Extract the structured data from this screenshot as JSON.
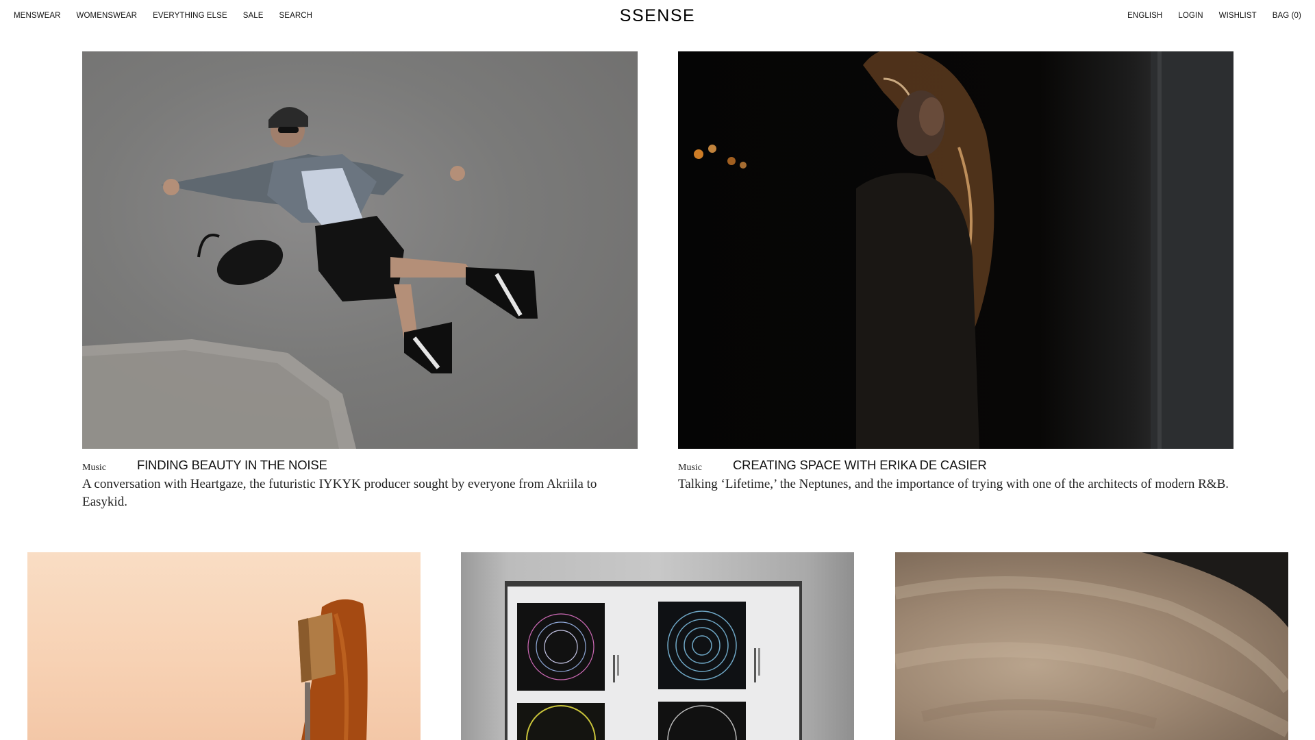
{
  "header": {
    "nav_left": [
      "MENSWEAR",
      "WOMENSWEAR",
      "EVERYTHING ELSE",
      "SALE",
      "SEARCH"
    ],
    "logo": "SSENSE",
    "nav_right": [
      "ENGLISH",
      "LOGIN",
      "WISHLIST",
      "BAG (0)"
    ]
  },
  "articles": [
    {
      "category": "Music",
      "title": "FINDING BEAUTY IN THE NOISE",
      "description": "A conversation with Heartgaze, the futuristic IYKYK producer sought by everyone from Akriila to Easykid.",
      "image": "photo-man-lying-on-asphalt"
    },
    {
      "category": "Music",
      "title": "CREATING SPACE WITH ERIKA DE CASIER",
      "description": "Talking ‘Lifetime,’ the Neptunes, and the importance of trying with one of the architects of modern R&B.",
      "image": "photo-woman-portrait-dark"
    },
    {
      "image": "photo-orange-hair-still-life"
    },
    {
      "image": "photo-vinyl-record-sleeves"
    },
    {
      "image": "photo-textured-rug"
    }
  ],
  "colors": {
    "background": "#ffffff",
    "text": "#111111"
  }
}
